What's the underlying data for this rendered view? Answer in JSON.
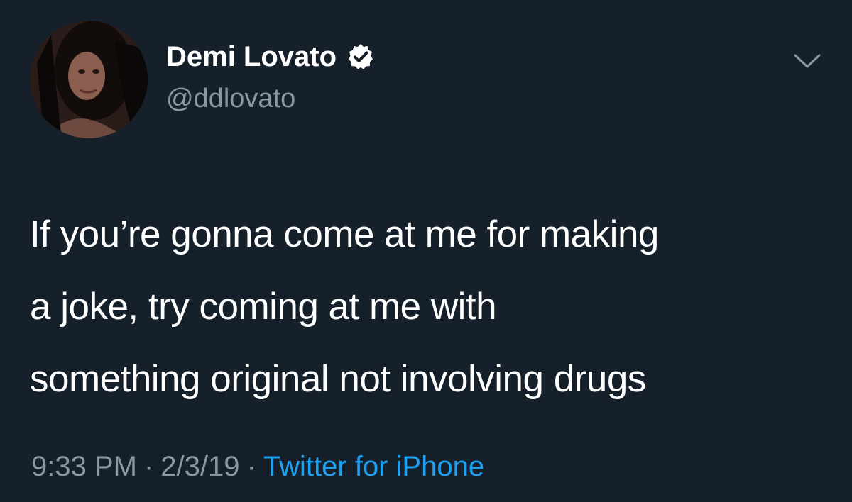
{
  "user": {
    "display_name": "Demi Lovato",
    "handle": "@ddlovato",
    "verified": true
  },
  "tweet": {
    "text_lines": [
      "If you’re gonna come at me for making",
      "a joke, try coming at me with",
      "something original not involving drugs"
    ],
    "time": "9:33 PM",
    "date": "2/3/19",
    "separator": "·",
    "source": "Twitter for iPhone"
  },
  "icons": {
    "verified": "verified-badge-icon",
    "menu": "chevron-down-icon"
  },
  "colors": {
    "background": "#15202b",
    "text": "#ffffff",
    "secondary_text": "#8899a6",
    "link": "#1da1f2"
  }
}
